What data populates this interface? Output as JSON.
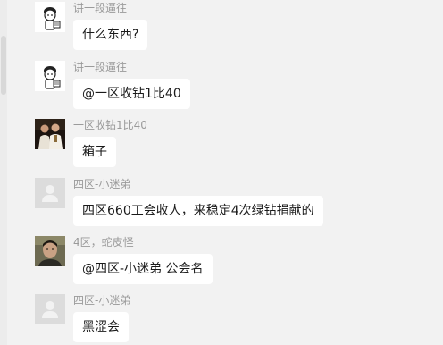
{
  "messages": [
    {
      "sender": "讲一段逼往",
      "text": "什么东西?",
      "avatar": "cartoon-avatar"
    },
    {
      "sender": "讲一段逼往",
      "text": "@一区收钻1比40",
      "avatar": "cartoon-avatar"
    },
    {
      "sender": "一区收钻1比40",
      "text": "箱子",
      "avatar": "photo-two-people-avatar"
    },
    {
      "sender": "四区-小迷弟",
      "text": "四区660工会收人，来稳定4次绿钻捐献的",
      "avatar": "default-person-avatar"
    },
    {
      "sender": "4区，蛇皮怪",
      "text": "@四区-小迷弟 公会名",
      "avatar": "photo-man-avatar"
    },
    {
      "sender": "四区-小迷弟",
      "text": "黑涩会",
      "avatar": "default-person-avatar"
    }
  ]
}
